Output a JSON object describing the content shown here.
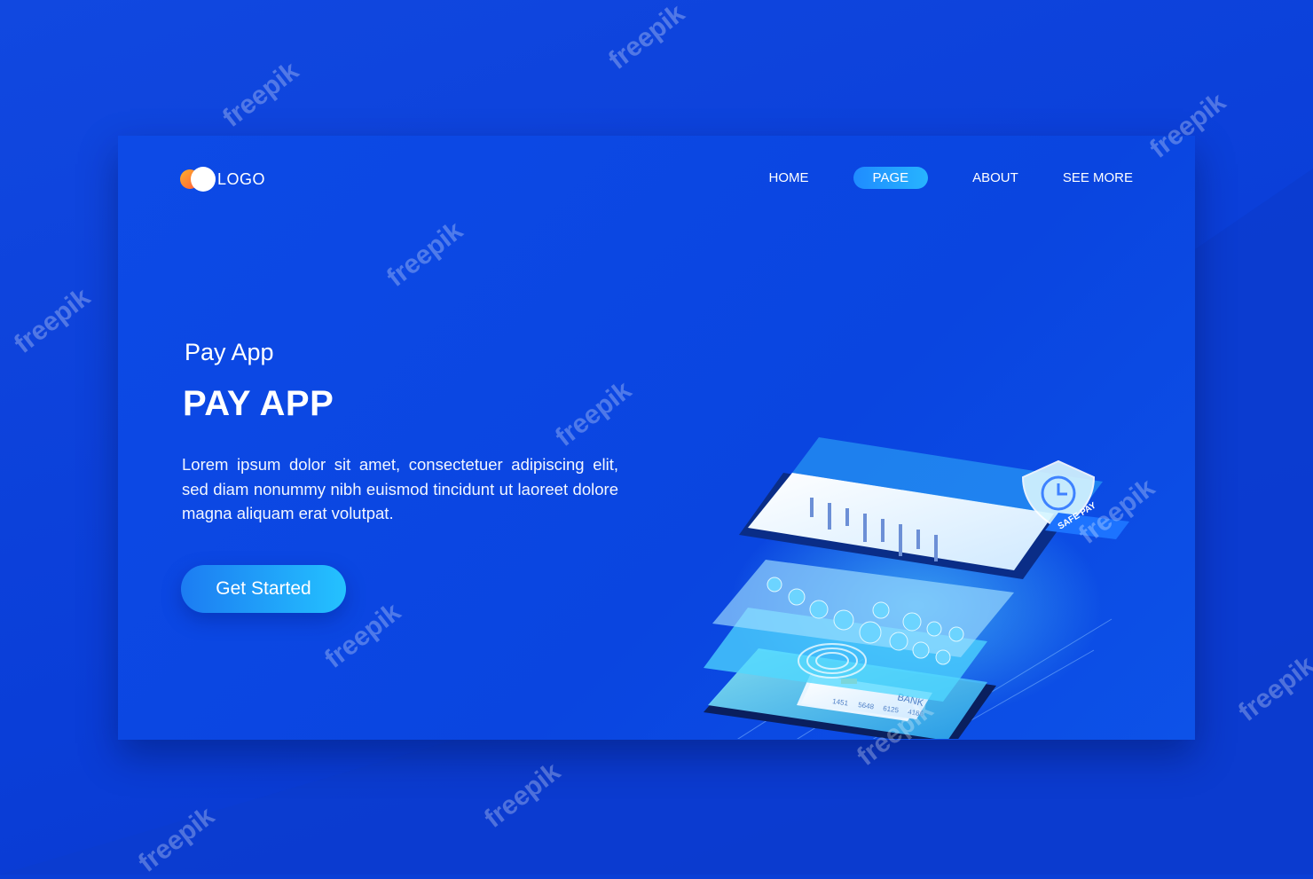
{
  "logo": {
    "text": "LOGO"
  },
  "nav": {
    "items": [
      {
        "label": "HOME",
        "active": false
      },
      {
        "label": "PAGE",
        "active": true
      },
      {
        "label": "ABOUT",
        "active": false
      },
      {
        "label": "SEE MORE",
        "active": false
      }
    ]
  },
  "hero": {
    "kicker": "Pay App",
    "headline": "PAY APP",
    "body": "Lorem ipsum dolor sit amet, consectetuer adipiscing elit, sed diam nonummy nibh euismod tincidunt ut laoreet dolore magna aliquam erat volutpat.",
    "cta_label": "Get Started"
  },
  "illustration": {
    "badge": "SAFE PAY",
    "card_numbers": [
      "1451",
      "5648",
      "6125",
      "4186"
    ],
    "card_bank": "BANK"
  },
  "watermark": {
    "text": "freepik"
  },
  "colors": {
    "background": "#0b3fd6",
    "panel": "#0a45e0",
    "accent": "#24b4ff",
    "glow": "#5ee6ff",
    "logo_dot": "#ff8a2c"
  }
}
